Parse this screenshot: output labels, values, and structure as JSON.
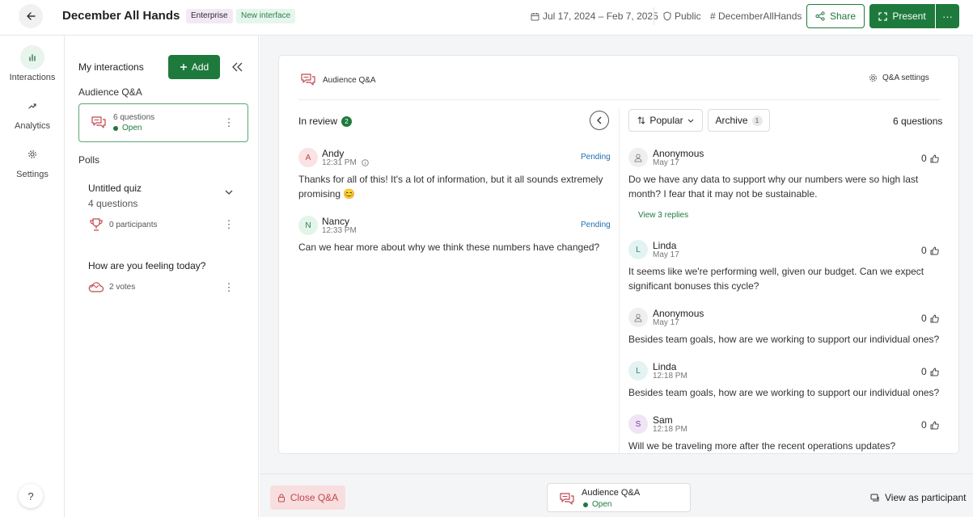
{
  "header": {
    "title": "December All Hands",
    "badge_enterprise": "Enterprise",
    "badge_new": "New interface",
    "date_range": "Jul 17, 2024 – Feb 7, 2025",
    "visibility": "Public",
    "hashtag": "# DecemberAllHands",
    "share_label": "Share",
    "present_label": "Present",
    "more_label": "···"
  },
  "nav": {
    "interactions": "Interactions",
    "analytics": "Analytics",
    "settings": "Settings",
    "help": "?"
  },
  "side_panel": {
    "title": "My interactions",
    "add_label": "Add",
    "audience_qa_label": "Audience Q&A",
    "qa_card": {
      "count": "6 questions",
      "status": "Open"
    },
    "polls_label": "Polls",
    "polls": [
      {
        "title": "Untitled quiz",
        "subtitle": "4 questions",
        "meta": "0 participants"
      },
      {
        "title": "How are you feeling today?",
        "meta": "2 votes"
      }
    ]
  },
  "qa_panel": {
    "title": "Audience Q&A",
    "settings_label": "Q&A settings",
    "in_review": {
      "label": "In review",
      "count": "2",
      "items": [
        {
          "initial": "A",
          "name": "Andy",
          "time": "12:31 PM",
          "status": "Pending",
          "text": "Thanks for all of this! It's a lot of information, but it all sounds extremely promising 😊"
        },
        {
          "initial": "N",
          "name": "Nancy",
          "time": "12:33 PM",
          "status": "Pending",
          "text": "Can we hear more about why we think these numbers have changed?"
        }
      ]
    },
    "sort_label": "Popular",
    "archive_label": "Archive",
    "archive_count": "1",
    "questions_count": "6 questions",
    "view_replies": "View 3 replies",
    "questions": [
      {
        "initial": "",
        "name": "Anonymous",
        "time": "May 17",
        "votes": "0",
        "text": "Do we have any data to support why our numbers were so high last month? I fear that it may not be sustainable."
      },
      {
        "initial": "L",
        "name": "Linda",
        "time": "May 17",
        "votes": "0",
        "text": "It seems like we're performing well, given our budget. Can we expect significant bonuses this cycle?"
      },
      {
        "initial": "",
        "name": "Anonymous",
        "time": "May 17",
        "votes": "0",
        "text": "Besides team goals, how are we working to support our individual ones?"
      },
      {
        "initial": "L",
        "name": "Linda",
        "time": "12:18 PM",
        "votes": "0",
        "text": "Besides team goals, how are we working to support our individual ones?"
      },
      {
        "initial": "S",
        "name": "Sam",
        "time": "12:18 PM",
        "votes": "0",
        "text": "Will we be traveling more after the recent operations updates?"
      }
    ]
  },
  "footer": {
    "close_label": "Close Q&A",
    "card_title": "Audience Q&A",
    "card_status": "Open",
    "view_participant": "View as participant"
  },
  "colors": {
    "brand_green": "#1e7a3c",
    "pending_blue": "#1f6fb0",
    "danger_red": "#c0464f"
  },
  "icons": [
    "back-arrow-icon",
    "calendar-icon",
    "shield-icon",
    "share-icon",
    "present-icon",
    "bar-chart-icon",
    "trend-icon",
    "gear-icon",
    "plus-icon",
    "double-chevron-left-icon",
    "chat-bubbles-icon",
    "kebab-icon",
    "chevron-down-icon",
    "trophy-icon",
    "cloud-icon",
    "info-icon",
    "chevron-left-icon",
    "sort-icon",
    "thumbs-up-icon",
    "person-icon",
    "lock-icon",
    "participant-icon"
  ]
}
